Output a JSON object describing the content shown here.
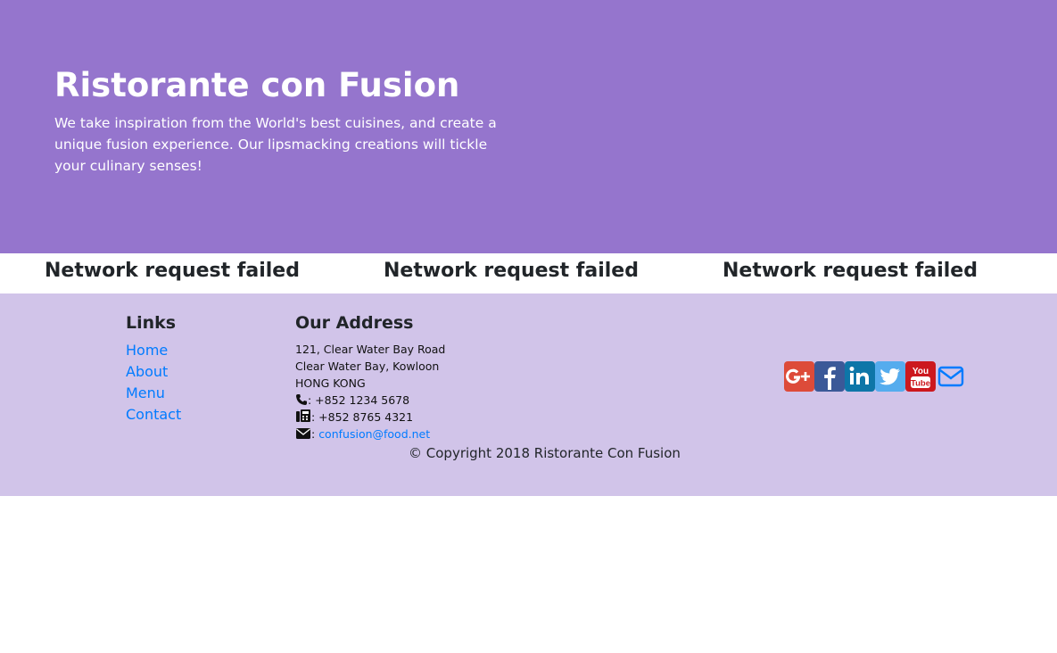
{
  "jumbotron": {
    "title": "Ristorante con Fusion",
    "description": "We take inspiration from the World's best cuisines, and create a unique fusion experience. Our lipsmacking creations will tickle your culinary senses!"
  },
  "errors": {
    "messages": [
      "Network request failed",
      "Network request failed",
      "Network request failed"
    ]
  },
  "footer": {
    "links_heading": "Links",
    "links": [
      "Home",
      "About",
      "Menu",
      "Contact"
    ],
    "address_heading": "Our Address",
    "address_lines": [
      "121, Clear Water Bay Road",
      "Clear Water Bay, Kowloon",
      "HONG KONG"
    ],
    "phone": ": +852 1234 5678",
    "fax": ": +852 8765 4321",
    "email_prefix": ": ",
    "email": "confusion@food.net",
    "social_icons": [
      "google-plus-icon",
      "facebook-icon",
      "linkedin-icon",
      "twitter-icon",
      "youtube-icon",
      "envelope-icon"
    ],
    "copyright": "© Copyright 2018 Ristorante Con Fusion"
  },
  "colors": {
    "header_bg": "#9575cd",
    "footer_bg": "#d1c4e9",
    "link": "#007bff",
    "google_plus": "#dd4b39",
    "facebook": "#3b5998",
    "linkedin": "#0e76a8",
    "twitter": "#55acee",
    "youtube": "#cc181e"
  }
}
